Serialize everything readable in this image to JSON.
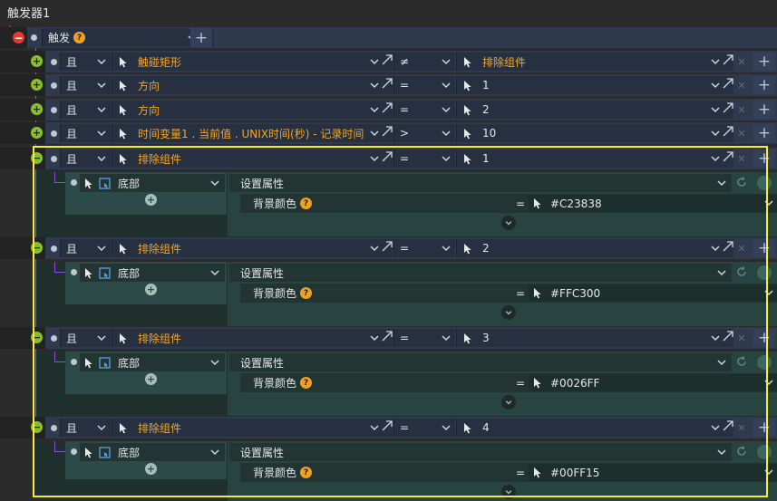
{
  "window_title": "触发器1",
  "trigger": {
    "label": "触发",
    "help": "?"
  },
  "conditions": [
    {
      "op": "且",
      "left": "触碰矩形",
      "cmp": "≠",
      "right": "排除组件",
      "right_orange": true
    },
    {
      "op": "且",
      "left": "方向",
      "cmp": "=",
      "right": "1",
      "right_orange": false
    },
    {
      "op": "且",
      "left": "方向",
      "cmp": "=",
      "right": "2",
      "right_orange": false
    },
    {
      "op": "且",
      "left": "时间变量1 . 当前值 . UNIX时间(秒) - 记录时间",
      "cmp": ">",
      "right": "10",
      "right_orange": false
    }
  ],
  "groups": [
    {
      "op": "且",
      "left": "排除组件",
      "cmp": "=",
      "right": "1",
      "target": "底部",
      "action": "设置属性",
      "prop": "背景颜色",
      "eq": "=",
      "value": "#C23838"
    },
    {
      "op": "且",
      "left": "排除组件",
      "cmp": "=",
      "right": "2",
      "target": "底部",
      "action": "设置属性",
      "prop": "背景颜色",
      "eq": "=",
      "value": "#FFC300"
    },
    {
      "op": "且",
      "left": "排除组件",
      "cmp": "=",
      "right": "3",
      "target": "底部",
      "action": "设置属性",
      "prop": "背景颜色",
      "eq": "=",
      "value": "#0026FF"
    },
    {
      "op": "且",
      "left": "排除组件",
      "cmp": "=",
      "right": "4",
      "target": "底部",
      "action": "设置属性",
      "prop": "背景颜色",
      "eq": "=",
      "value": "#00FF15"
    }
  ],
  "icons": {
    "pointer": "pointer-icon",
    "chevron": "chevron-down-icon",
    "expand": "expand-arrow-icon",
    "add": "plus-icon",
    "remove": "close-icon",
    "component": "component-icon"
  },
  "colors": {
    "highlight": "#f5e942",
    "orange": "#f5a623",
    "red": "#e53935",
    "green": "#8bbf2a"
  }
}
